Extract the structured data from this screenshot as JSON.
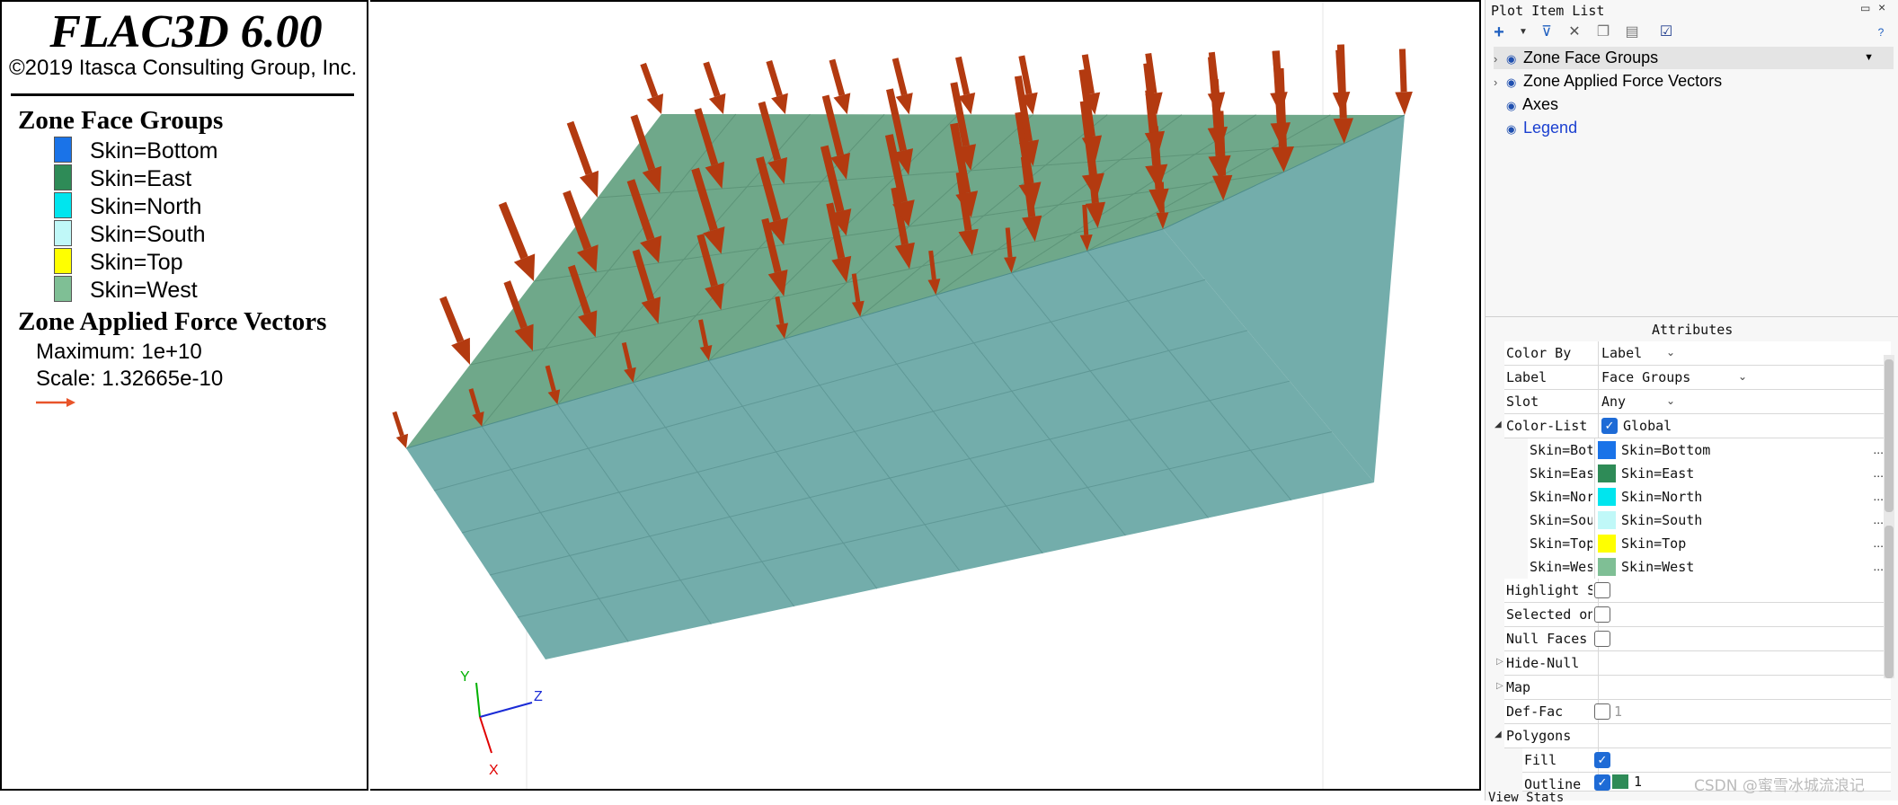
{
  "legend": {
    "app_title": "FLAC3D 6.00",
    "copyright": "©2019 Itasca Consulting Group, Inc.",
    "groups_title": "Zone Face Groups",
    "groups": [
      {
        "label": "Skin=Bottom",
        "color": "#1a73e8"
      },
      {
        "label": "Skin=East",
        "color": "#2e8b57"
      },
      {
        "label": "Skin=North",
        "color": "#00e5ee"
      },
      {
        "label": "Skin=South",
        "color": "#c0f8f8"
      },
      {
        "label": "Skin=Top",
        "color": "#ffff00"
      },
      {
        "label": "Skin=West",
        "color": "#7fbf95"
      }
    ],
    "vectors_title": "Zone Applied Force Vectors",
    "maximum": "Maximum: 1e+10",
    "scale": "Scale: 1.32665e-10",
    "arrow_color": "#e8542a"
  },
  "viewport": {
    "axes": {
      "y": "Y",
      "z": "Z",
      "x": "X"
    },
    "top_face_color": "#6fa88a",
    "side_face_color": "#73adab",
    "vector_color": "#b33a10"
  },
  "panel": {
    "title": "Plot Item List",
    "toolbar_icons": [
      "add-icon",
      "dropdown-arrow-icon",
      "filter-icon",
      "delete-icon",
      "copy-icon",
      "paste-icon",
      "checkbox-icon",
      "help-icon"
    ],
    "tree": [
      {
        "label": "Zone Face Groups",
        "selected": true
      },
      {
        "label": "Zone Applied Force Vectors",
        "selected": false
      },
      {
        "label": "Axes",
        "selected": false
      },
      {
        "label": "Legend",
        "selected": false
      }
    ],
    "attributes_title": "Attributes",
    "attrs": {
      "color_by": {
        "key": "Color By",
        "value": "Label"
      },
      "label": {
        "key": "Label",
        "value": "Face Groups"
      },
      "slot": {
        "key": "Slot",
        "value": "Any"
      },
      "color_list": {
        "key": "Color-List",
        "value": "Global"
      },
      "color_rows": [
        {
          "key": "Skin=Bottom",
          "value": "Skin=Bottom",
          "color": "#1a73e8"
        },
        {
          "key": "Skin=East",
          "value": "Skin=East",
          "color": "#2e8b57"
        },
        {
          "key": "Skin=North",
          "value": "Skin=North",
          "color": "#00e5ee"
        },
        {
          "key": "Skin=South",
          "value": "Skin=South",
          "color": "#c0f8f8"
        },
        {
          "key": "Skin=Top",
          "value": "Skin=Top",
          "color": "#ffff00"
        },
        {
          "key": "Skin=West",
          "value": "Skin=West",
          "color": "#7fbf95"
        }
      ],
      "highlight": {
        "key": "Highlight Selected"
      },
      "selected_only": {
        "key": "Selected only"
      },
      "null_faces": {
        "key": "Null Faces"
      },
      "hide_null": {
        "key": "Hide-Null"
      },
      "map": {
        "key": "Map"
      },
      "def_fac": {
        "key": "Def-Fac",
        "value": "1"
      },
      "polygons": {
        "key": "Polygons"
      },
      "fill": {
        "key": "Fill"
      },
      "outline": {
        "key": "Outline",
        "value": "1"
      }
    },
    "view_stats": "View Stats",
    "watermark": "CSDN @蜜雪冰城流浪记"
  }
}
